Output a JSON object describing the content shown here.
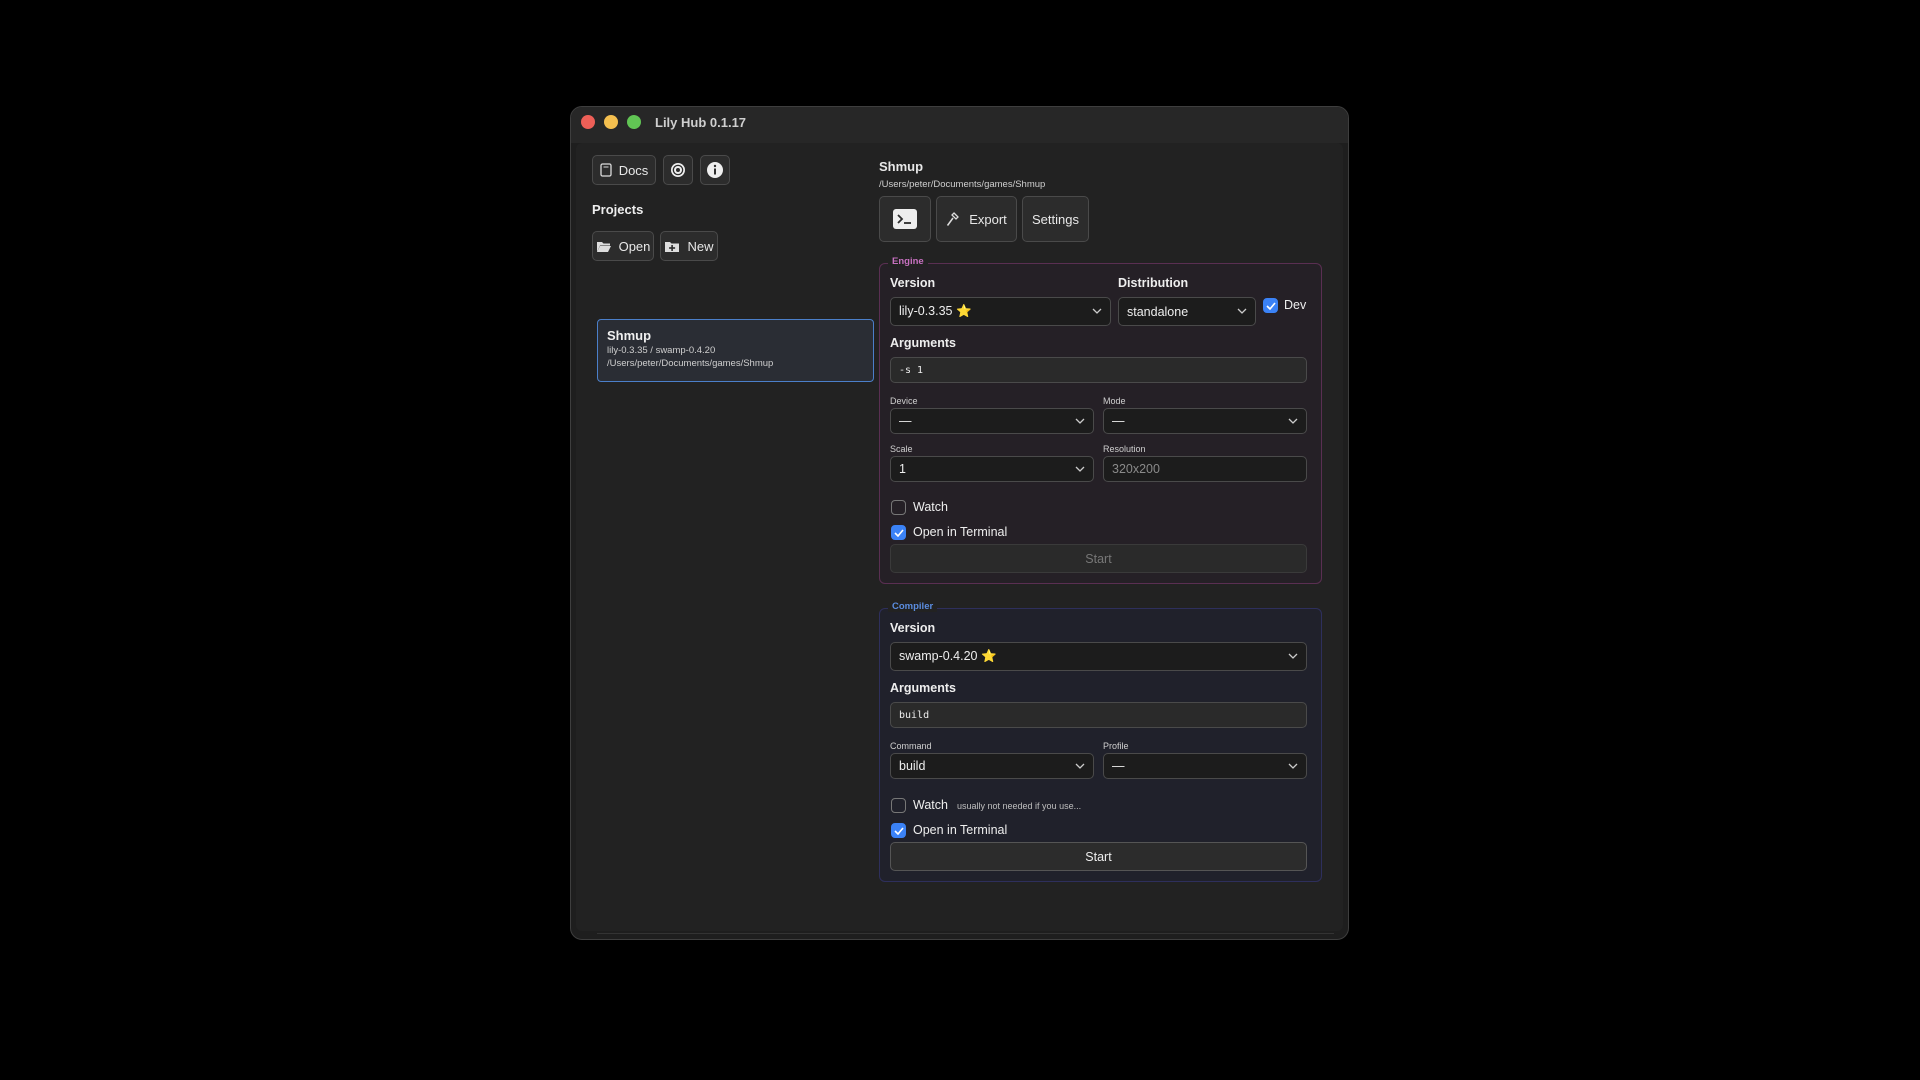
{
  "window": {
    "title": "Lily Hub 0.1.17"
  },
  "toolbar": {
    "docs_label": "Docs"
  },
  "projects": {
    "heading": "Projects",
    "open_label": "Open",
    "new_label": "New",
    "items": [
      {
        "name": "Shmup",
        "versions": "lily-0.3.35 / swamp-0.4.20",
        "path": "/Users/peter/Documents/games/Shmup"
      }
    ]
  },
  "project": {
    "title": "Shmup",
    "path": "/Users/peter/Documents/games/Shmup",
    "export_label": "Export",
    "settings_label": "Settings"
  },
  "engine": {
    "legend": "Engine",
    "version_label": "Version",
    "version_value": "lily-0.3.35 ⭐",
    "distribution_label": "Distribution",
    "distribution_value": "standalone",
    "dev_label": "Dev",
    "dev_checked": true,
    "arguments_label": "Arguments",
    "arguments_value": "-s 1",
    "device_label": "Device",
    "device_value": "—",
    "mode_label": "Mode",
    "mode_value": "—",
    "scale_label": "Scale",
    "scale_value": "1",
    "resolution_label": "Resolution",
    "resolution_placeholder": "320x200",
    "watch_label": "Watch",
    "watch_checked": false,
    "terminal_label": "Open in Terminal",
    "terminal_checked": true,
    "start_label": "Start"
  },
  "compiler": {
    "legend": "Compiler",
    "version_label": "Version",
    "version_value": "swamp-0.4.20 ⭐",
    "arguments_label": "Arguments",
    "arguments_value": "build",
    "command_label": "Command",
    "command_value": "build",
    "profile_label": "Profile",
    "profile_value": "—",
    "watch_label": "Watch",
    "watch_hint": "usually not needed if you use...",
    "watch_checked": false,
    "terminal_label": "Open in Terminal",
    "terminal_checked": true,
    "start_label": "Start"
  },
  "footer": {
    "terminal_glyph": ">_"
  },
  "colors": {
    "accent": "#3b82f6",
    "engine": "#c770c0",
    "compiler": "#5b8de0"
  }
}
